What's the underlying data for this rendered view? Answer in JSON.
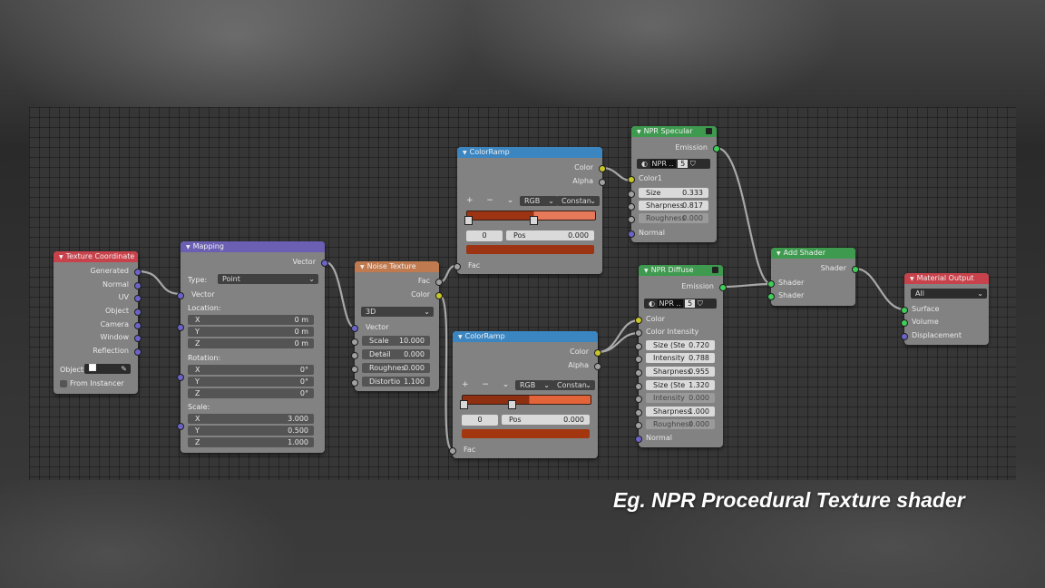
{
  "caption": "Eg. NPR Procedural Texture shader",
  "nodes": {
    "texcoord": {
      "title": "Texture Coordinate",
      "outputs": [
        "Generated",
        "Normal",
        "UV",
        "Object",
        "Camera",
        "Window",
        "Reflection"
      ],
      "object_label": "Object:",
      "from_instancer": "From Instancer"
    },
    "mapping": {
      "title": "Mapping",
      "output": "Vector",
      "type_label": "Type:",
      "type_value": "Point",
      "vector_input": "Vector",
      "location_label": "Location:",
      "location": [
        {
          "axis": "X",
          "value": "0 m"
        },
        {
          "axis": "Y",
          "value": "0 m"
        },
        {
          "axis": "Z",
          "value": "0 m"
        }
      ],
      "rotation_label": "Rotation:",
      "rotation": [
        {
          "axis": "X",
          "value": "0°"
        },
        {
          "axis": "Y",
          "value": "0°"
        },
        {
          "axis": "Z",
          "value": "0°"
        }
      ],
      "scale_label": "Scale:",
      "scale": [
        {
          "axis": "X",
          "value": "3.000"
        },
        {
          "axis": "Y",
          "value": "0.500"
        },
        {
          "axis": "Z",
          "value": "1.000"
        }
      ]
    },
    "noise": {
      "title": "Noise Texture",
      "outputs": [
        "Fac",
        "Color"
      ],
      "dimension": "3D",
      "vector_input": "Vector",
      "fields": [
        {
          "label": "Scale",
          "value": "10.000"
        },
        {
          "label": "Detail",
          "value": "0.000"
        },
        {
          "label": "Roughnes",
          "value": "0.000"
        },
        {
          "label": "Distortio",
          "value": "1.100"
        }
      ]
    },
    "ramp1": {
      "title": "ColorRamp",
      "outputs": [
        "Color",
        "Alpha"
      ],
      "tools": "+ − ⌄",
      "mode": "RGB",
      "interp": "Constan",
      "index": "0",
      "pos_label": "Pos",
      "pos_value": "0.000",
      "input": "Fac",
      "colors": {
        "left": "#9c3413",
        "right": "#e6795a",
        "swatch": "#9c3413"
      }
    },
    "ramp2": {
      "title": "ColorRamp",
      "outputs": [
        "Color",
        "Alpha"
      ],
      "tools": "+ − ⌄",
      "mode": "RGB",
      "interp": "Constan",
      "index": "0",
      "pos_label": "Pos",
      "pos_value": "0.000",
      "input": "Fac",
      "colors": {
        "left": "#8e2f12",
        "right": "#e4643a",
        "swatch": "#a3360f"
      }
    },
    "specular": {
      "title": "NPR Specular",
      "output": "Emission",
      "group_name": "NPR ..",
      "users": "5",
      "color_input": "Color1",
      "fields": [
        {
          "label": "Size",
          "value": "0.333"
        },
        {
          "label": "Sharpness",
          "value": "0.817"
        },
        {
          "label": "Roughness",
          "value": "0.000"
        }
      ],
      "normal": "Normal"
    },
    "diffuse": {
      "title": "NPR Diffuse",
      "output": "Emission",
      "group_name": "NPR ..",
      "users": "5",
      "inputs": [
        "Color",
        "Color Intensity"
      ],
      "fields": [
        {
          "label": "Size (Ste",
          "value": "0.720"
        },
        {
          "label": "Intensity",
          "value": "0.788"
        },
        {
          "label": "Sharpness",
          "value": "0.955"
        },
        {
          "label": "Size (Ste",
          "value": "1.320"
        },
        {
          "label": "Intensity",
          "value": "0.000"
        },
        {
          "label": "Sharpness",
          "value": "1.000"
        },
        {
          "label": "Roughness",
          "value": "0.000"
        }
      ],
      "normal": "Normal"
    },
    "addshader": {
      "title": "Add Shader",
      "output": "Shader",
      "inputs": [
        "Shader",
        "Shader"
      ]
    },
    "output": {
      "title": "Material Output",
      "target": "All",
      "inputs": [
        "Surface",
        "Volume",
        "Displacement"
      ]
    }
  },
  "socket_colors": {
    "vector": "#6b64c8",
    "color": "#c7c729",
    "float": "#a1a1a1",
    "shader": "#3fce5a"
  },
  "link_color": "#a8a8a8"
}
